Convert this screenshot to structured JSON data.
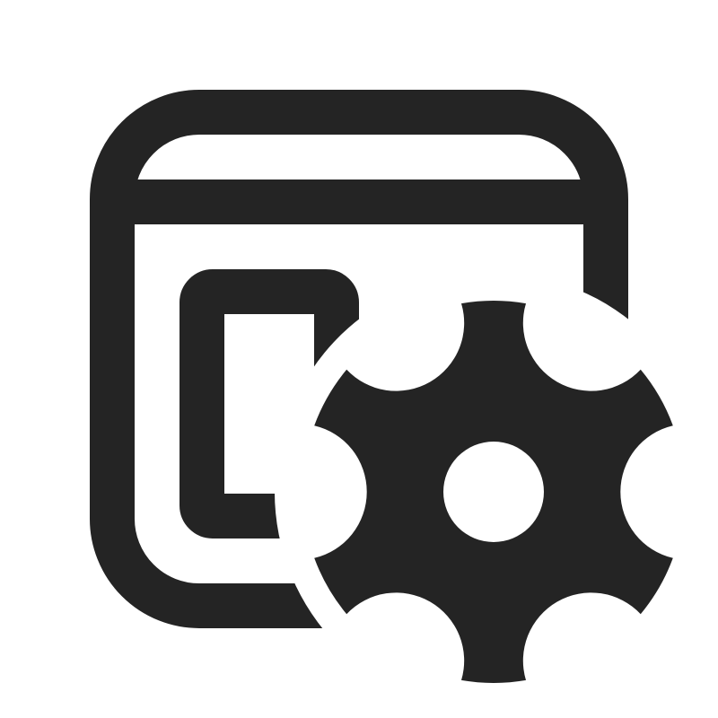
{
  "icon": {
    "name": "window-settings-icon",
    "color": "#242424",
    "background": "#ffffff"
  }
}
